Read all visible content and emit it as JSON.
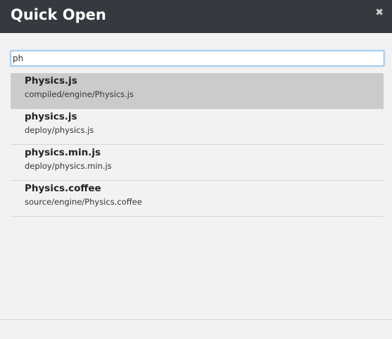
{
  "dialog": {
    "title": "Quick Open",
    "close_icon": "close-icon"
  },
  "search": {
    "value": "ph"
  },
  "results": [
    {
      "name": "Physics.js",
      "path": "compiled/engine/Physics.js",
      "selected": true
    },
    {
      "name": "physics.js",
      "path": "deploy/physics.js"
    },
    {
      "name": "physics.min.js",
      "path": "deploy/physics.min.js"
    },
    {
      "name": "Physics.coffee",
      "path": "source/engine/Physics.coffee"
    }
  ]
}
